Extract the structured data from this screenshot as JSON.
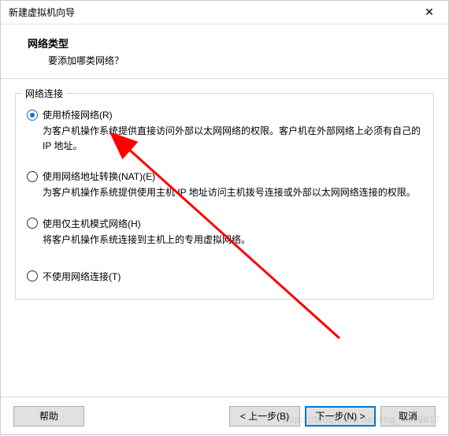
{
  "titlebar": {
    "title": "新建虚拟机向导",
    "close": "✕"
  },
  "header": {
    "title": "网络类型",
    "subtitle": "要添加哪类网络？"
  },
  "group": {
    "legend": "网络连接"
  },
  "options": [
    {
      "label": "使用桥接网络(R)",
      "desc": "为客户机操作系统提供直接访问外部以太网网络的权限。客户机在外部网络上必须有自己的 IP 地址。",
      "selected": true
    },
    {
      "label": "使用网络地址转换(NAT)(E)",
      "desc": "为客户机操作系统提供使用主机 IP 地址访问主机拨号连接或外部以太网网络连接的权限。",
      "selected": false
    },
    {
      "label": "使用仅主机模式网络(H)",
      "desc": "将客户机操作系统连接到主机上的专用虚拟网络。",
      "selected": false
    },
    {
      "label": "不使用网络连接(T)",
      "desc": "",
      "selected": false
    }
  ],
  "buttons": {
    "help": "帮助",
    "back": "< 上一步(B)",
    "next": "下一步(N) >",
    "cancel": "取消"
  },
  "watermark": "https://blog.csdn.net/ling_4899817"
}
